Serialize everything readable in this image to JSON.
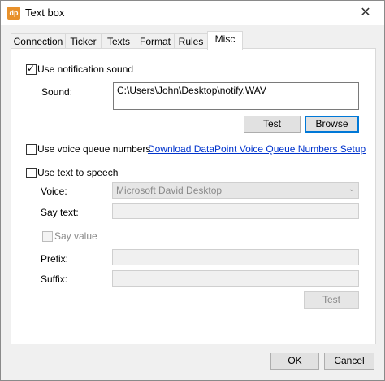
{
  "window": {
    "title": "Text box",
    "app_icon_text": "dp",
    "close_glyph": "✕"
  },
  "tabs": [
    {
      "label": "Connection"
    },
    {
      "label": "Ticker"
    },
    {
      "label": "Texts"
    },
    {
      "label": "Format"
    },
    {
      "label": "Rules"
    },
    {
      "label": "Misc",
      "active": true
    }
  ],
  "misc": {
    "notification": {
      "label": "Use notification sound",
      "checked": true
    },
    "sound": {
      "label": "Sound:",
      "value": "C:\\Users\\John\\Desktop\\notify.WAV"
    },
    "test_button": "Test",
    "browse_button": "Browse",
    "voice_queue": {
      "label": "Use voice queue numbers",
      "checked": false,
      "link": "Download DataPoint Voice Queue Numbers Setup"
    },
    "tts": {
      "label": "Use text to speech",
      "checked": false
    },
    "voice": {
      "label": "Voice:",
      "value": "Microsoft David Desktop"
    },
    "say_text": {
      "label": "Say text:",
      "value": ""
    },
    "say_value": {
      "label": "Say value",
      "checked": false
    },
    "prefix": {
      "label": "Prefix:",
      "value": ""
    },
    "suffix": {
      "label": "Suffix:",
      "value": ""
    },
    "tts_test_button": "Test"
  },
  "footer": {
    "ok": "OK",
    "cancel": "Cancel"
  }
}
